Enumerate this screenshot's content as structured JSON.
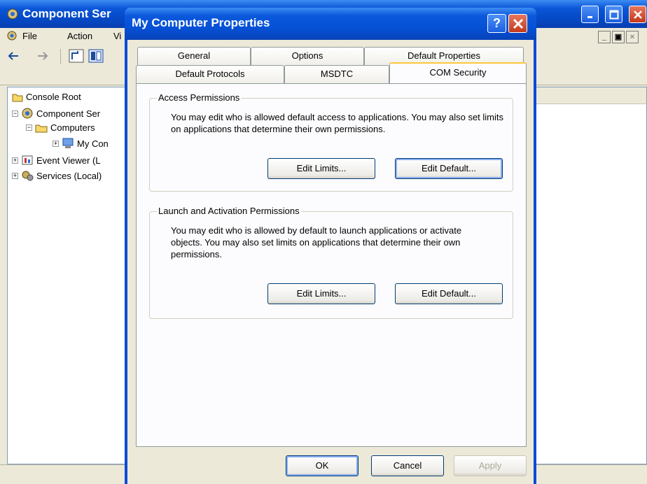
{
  "background_window": {
    "title": "Component Ser",
    "menu": [
      "File",
      "Action",
      "Vi"
    ],
    "tree": [
      {
        "label": "Console Root"
      },
      {
        "label": "Component Ser"
      },
      {
        "label": "Computers"
      },
      {
        "label": "My Con"
      },
      {
        "label": "Event Viewer (L"
      },
      {
        "label": "Services (Local)"
      }
    ]
  },
  "dialog": {
    "title": "My Computer Properties",
    "help_label": "?",
    "tabs_row_back": [
      "General",
      "Options",
      "Default Properties"
    ],
    "tabs_row_front": [
      "Default Protocols",
      "MSDTC",
      "COM Security"
    ],
    "active_tab": "COM Security",
    "access": {
      "legend": "Access Permissions",
      "text": "You may edit who is allowed default access to applications. You may also set limits on applications that determine their own permissions.",
      "edit_limits": "Edit Limits...",
      "edit_default": "Edit Default..."
    },
    "launch": {
      "legend": "Launch and Activation Permissions",
      "text": "You may edit who is allowed by default to launch applications or activate objects. You may also set limits on applications that determine their own permissions.",
      "edit_limits": "Edit Limits...",
      "edit_default": "Edit Default..."
    },
    "buttons": {
      "ok": "OK",
      "cancel": "Cancel",
      "apply": "Apply"
    }
  },
  "colors": {
    "titlebar": "#0a56d8",
    "face": "#ece9d8",
    "tab_highlight": "#ffc83c"
  }
}
